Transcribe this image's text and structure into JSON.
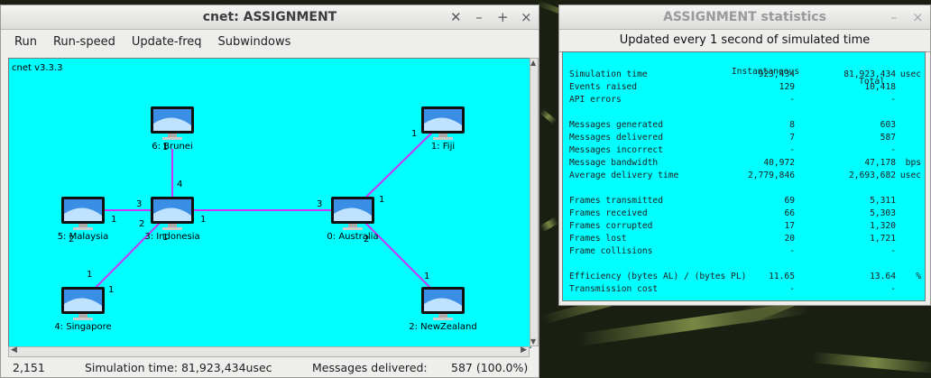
{
  "main_window": {
    "title": "cnet: ASSIGNMENT",
    "controls": [
      "✕",
      "–",
      "+",
      "×"
    ],
    "menu": [
      "Run",
      "Run-speed",
      "Update-freq",
      "Subwindows"
    ],
    "version": "cnet v3.3.3",
    "nodes": [
      {
        "id": "brunei",
        "label": "6: Brunei"
      },
      {
        "id": "fiji",
        "label": "1: Fiji"
      },
      {
        "id": "malaysia",
        "label": "5: Malaysia"
      },
      {
        "id": "indonesia",
        "label": "3: Indonesia"
      },
      {
        "id": "australia",
        "label": "0: Australia"
      },
      {
        "id": "singapore",
        "label": "4: Singapore"
      },
      {
        "id": "newzealand",
        "label": "2: NewZealand"
      }
    ],
    "link_labels": [
      "1",
      "4",
      "1",
      "3",
      "3",
      "1",
      "2",
      "1",
      "1",
      "2",
      "2",
      "1",
      "1",
      "1",
      "1"
    ],
    "status": {
      "cursor": "2,151",
      "sim_time": "Simulation time: 81,923,434usec",
      "messages_label": "Messages delivered:",
      "messages_value": "587 (100.0%)"
    }
  },
  "stats_window": {
    "title": "ASSIGNMENT statistics",
    "subtitle": "Updated every 1 second of simulated time",
    "headers": {
      "instantaneous": "Instantaneous",
      "total": "Total"
    },
    "rows": [
      {
        "name": "Simulation time",
        "inst": "923,434",
        "total": "81,923,434",
        "unit": "usec"
      },
      {
        "name": "Events raised",
        "inst": "129",
        "total": "10,418",
        "unit": ""
      },
      {
        "name": "API errors",
        "inst": "-",
        "total": "-",
        "unit": ""
      },
      {
        "name": "Messages generated",
        "inst": "8",
        "total": "603",
        "unit": ""
      },
      {
        "name": "Messages delivered",
        "inst": "7",
        "total": "587",
        "unit": ""
      },
      {
        "name": "Messages incorrect",
        "inst": "-",
        "total": "-",
        "unit": ""
      },
      {
        "name": "Message bandwidth",
        "inst": "40,972",
        "total": "47,178",
        "unit": "bps"
      },
      {
        "name": "Average delivery time",
        "inst": "2,779,846",
        "total": "2,693,682",
        "unit": "usec"
      },
      {
        "name": "Frames transmitted",
        "inst": "69",
        "total": "5,311",
        "unit": ""
      },
      {
        "name": "Frames received",
        "inst": "66",
        "total": "5,303",
        "unit": ""
      },
      {
        "name": "Frames corrupted",
        "inst": "17",
        "total": "1,320",
        "unit": ""
      },
      {
        "name": "Frames lost",
        "inst": "20",
        "total": "1,721",
        "unit": ""
      },
      {
        "name": "Frame collisions",
        "inst": "-",
        "total": "-",
        "unit": ""
      },
      {
        "name": "Efficiency (bytes AL) / (bytes PL)",
        "inst": "11.65",
        "total": "13.64",
        "unit": "%"
      },
      {
        "name": "Transmission cost",
        "inst": "-",
        "total": "-",
        "unit": ""
      }
    ]
  },
  "colors": {
    "canvas": "#00ffff",
    "link": "#cc33ff"
  }
}
